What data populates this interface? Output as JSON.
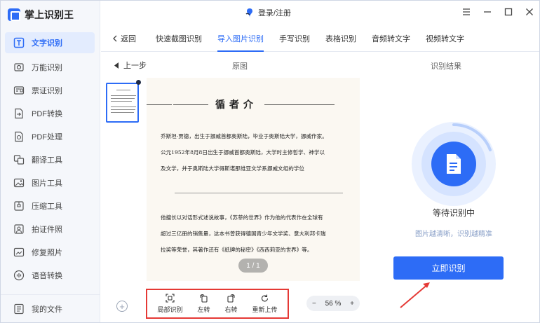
{
  "app": {
    "title": "掌上识别王"
  },
  "sidebar": {
    "items": [
      {
        "label": "文字识别",
        "icon": "text-recognition-icon",
        "active": true
      },
      {
        "label": "万能识别",
        "icon": "universal-scan-icon"
      },
      {
        "label": "票证识别",
        "icon": "ticket-icon"
      },
      {
        "label": "PDF转换",
        "icon": "pdf-convert-icon"
      },
      {
        "label": "PDF处理",
        "icon": "pdf-process-icon"
      },
      {
        "label": "翻译工具",
        "icon": "translate-icon"
      },
      {
        "label": "图片工具",
        "icon": "image-tools-icon"
      },
      {
        "label": "压缩工具",
        "icon": "compress-icon"
      },
      {
        "label": "拍证件照",
        "icon": "id-photo-icon"
      },
      {
        "label": "修复照片",
        "icon": "repair-photo-icon"
      },
      {
        "label": "语音转换",
        "icon": "voice-convert-icon"
      }
    ],
    "my_files": "我的文件"
  },
  "header": {
    "login": "登录/注册"
  },
  "tabs": {
    "back": "返回",
    "items": [
      "快速截图识别",
      "导入图片识别",
      "手写识别",
      "表格识别",
      "音频转文字",
      "视频转文字"
    ],
    "active_index": 1
  },
  "content": {
    "prev_step": "上一步",
    "original_label": "原图",
    "result_label": "识别结果",
    "page_indicator": "1 / 1"
  },
  "document": {
    "title": "循者介",
    "lines": [
      "乔斯坦·贾德，出生于挪威首都奥斯陆，毕业于奥斯陆大学，挪威作家。",
      "公元1952年8月8日出生于挪威首都奥斯陆，大学时主修哲学、神学以",
      "及文学，并于奥斯陆大学得斯堪那维亚文学系挪威文组的学位",
      "他擅长以对话形式述说故事，《苏菲的世界》作为他的代表作在全球有",
      "超过三亿册的销售量，这本书曾获得德国青少年文学奖、意大利邦卡瑞",
      "拉奖等荣誉，其著作还有《纸牌的秘密》《西西莉亚的世界》等。"
    ]
  },
  "toolbar": {
    "tools": [
      {
        "label": "局部识别",
        "icon": "crop-recognize-icon"
      },
      {
        "label": "左转",
        "icon": "rotate-left-icon"
      },
      {
        "label": "右转",
        "icon": "rotate-right-icon"
      },
      {
        "label": "重新上传",
        "icon": "reupload-icon"
      }
    ]
  },
  "zoom": {
    "minus": "−",
    "value": "56 %",
    "plus": "+"
  },
  "result": {
    "status": "等待识别中",
    "hint": "图片越清晰，识别越精准",
    "button": "立即识别"
  },
  "colors": {
    "accent": "#2d6cf6",
    "highlight_box": "#e53935"
  }
}
